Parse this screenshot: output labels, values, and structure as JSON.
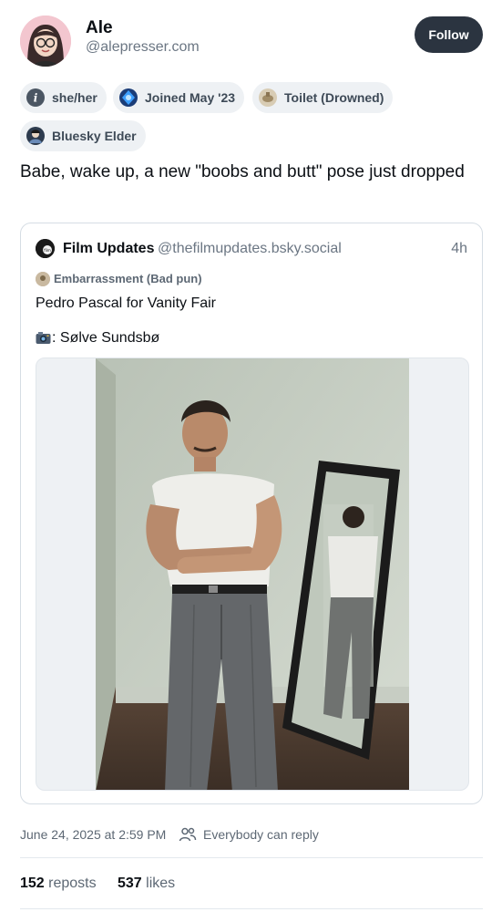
{
  "author": {
    "display_name": "Ale",
    "handle": "@alepresser.com"
  },
  "follow_button": {
    "label": "Follow"
  },
  "badges": [
    {
      "label": "she/her",
      "icon": "pronouns-icon"
    },
    {
      "label": "Joined May '23",
      "icon": "joined-globe-icon"
    },
    {
      "label": "Toilet (Drowned)",
      "icon": "toilet-icon"
    },
    {
      "label": "Bluesky Elder",
      "icon": "elder-icon"
    }
  ],
  "post": {
    "text": "Babe, wake up, a new \"boobs and butt\" pose just dropped"
  },
  "quote": {
    "name": "Film Updates",
    "handle": "@thefilmupdates.bsky.social",
    "time": "4h",
    "badge_label": "Embarrassment (Bad pun)",
    "text_line1": "Pedro Pascal for Vanity Fair",
    "text_line2": ": Sølve Sundsbø",
    "image_description_icon": "camera-icon"
  },
  "meta": {
    "date": "June 24, 2025 at 2:59 PM",
    "reply_setting": "Everybody can reply"
  },
  "stats": {
    "reposts_count": "152",
    "reposts_label": "reposts",
    "likes_count": "537",
    "likes_label": "likes"
  },
  "colors": {
    "follow_bg": "#2b3440",
    "badge_bg": "#eef1f4",
    "muted_text": "#6b7683",
    "border": "#d6dde4"
  }
}
